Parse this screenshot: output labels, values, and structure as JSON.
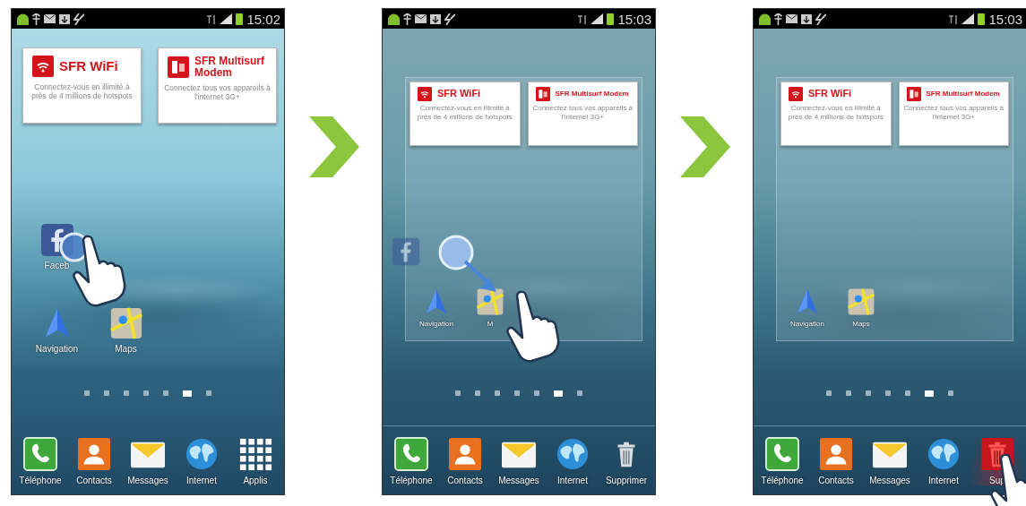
{
  "screens": [
    {
      "status_bar": {
        "time": "15:02"
      },
      "editing": false,
      "gesture": {
        "kind": "tap"
      },
      "widgets": [
        {
          "kind": "wifi",
          "title": "SFR WiFi",
          "text": "Connectez-vous en illimité à près de 4 millions de hotspots"
        },
        {
          "kind": "modem",
          "title": "SFR Multisurf Modem",
          "text": "Connectez tous vos appareils à l'internet 3G+"
        }
      ],
      "app_rows": [
        [
          {
            "kind": "facebook",
            "label": "Faceb",
            "dragging": false
          }
        ],
        [
          {
            "kind": "navigation",
            "label": "Navigation",
            "dragging": false
          },
          {
            "kind": "maps",
            "label": "Maps",
            "dragging": false
          }
        ]
      ],
      "page_dots": [
        {
          "selected": false
        },
        {
          "selected": false
        },
        {
          "selected": false
        },
        {
          "selected": false
        },
        {
          "selected": false
        },
        {
          "selected": true
        },
        {
          "selected": false
        }
      ],
      "dock": [
        {
          "kind": "phone",
          "label": "Téléphone",
          "highlighted": false
        },
        {
          "kind": "contacts",
          "label": "Contacts",
          "highlighted": false
        },
        {
          "kind": "messages",
          "label": "Messages",
          "highlighted": false
        },
        {
          "kind": "internet",
          "label": "Internet",
          "highlighted": false
        },
        {
          "kind": "apps",
          "label": "Applis",
          "highlighted": false
        }
      ]
    },
    {
      "status_bar": {
        "time": "15:03"
      },
      "editing": true,
      "gesture": {
        "kind": "drag"
      },
      "widgets": [
        {
          "kind": "wifi",
          "title": "SFR WiFi",
          "text": "Connectez-vous en illimité à près de 4 millions de hotspots"
        },
        {
          "kind": "modem",
          "title": "SFR Multisurf Modem",
          "text": "Connectez tous vos appareils à l'internet 3G+"
        }
      ],
      "app_rows": [
        [
          {
            "kind": "facebook",
            "dragging": true
          }
        ],
        [
          {
            "kind": "navigation",
            "label": "Navigation",
            "dragging": false
          },
          {
            "kind": "maps",
            "label": "M",
            "dragging": false
          }
        ]
      ],
      "page_dots": [
        {
          "selected": false
        },
        {
          "selected": false
        },
        {
          "selected": false
        },
        {
          "selected": false
        },
        {
          "selected": false
        },
        {
          "selected": true
        },
        {
          "selected": false
        }
      ],
      "dock": [
        {
          "kind": "phone",
          "label": "Téléphone",
          "highlighted": false
        },
        {
          "kind": "contacts",
          "label": "Contacts",
          "highlighted": false
        },
        {
          "kind": "messages",
          "label": "Messages",
          "highlighted": false
        },
        {
          "kind": "internet",
          "label": "Internet",
          "highlighted": false
        },
        {
          "kind": "trash",
          "label": "Supprimer",
          "highlighted": false
        }
      ]
    },
    {
      "status_bar": {
        "time": "15:03"
      },
      "editing": true,
      "gesture": {
        "kind": "delete"
      },
      "widgets": [
        {
          "kind": "wifi",
          "title": "SFR WiFi",
          "text": "Connectez-vous en illimité à près de 4 millions de hotspots"
        },
        {
          "kind": "modem",
          "title": "SFR Multisurf Modem",
          "text": "Connectez tous vos appareils à l'internet 3G+"
        }
      ],
      "app_rows": [
        [
          {
            "kind": "navigation",
            "label": "Navigation",
            "dragging": false
          },
          {
            "kind": "maps",
            "label": "Maps",
            "dragging": false
          }
        ]
      ],
      "page_dots": [
        {
          "selected": false
        },
        {
          "selected": false
        },
        {
          "selected": false
        },
        {
          "selected": false
        },
        {
          "selected": false
        },
        {
          "selected": true
        },
        {
          "selected": false
        }
      ],
      "dock": [
        {
          "kind": "phone",
          "label": "Téléphone",
          "highlighted": false
        },
        {
          "kind": "contacts",
          "label": "Contacts",
          "highlighted": false
        },
        {
          "kind": "messages",
          "label": "Messages",
          "highlighted": false
        },
        {
          "kind": "internet",
          "label": "Internet",
          "highlighted": false
        },
        {
          "kind": "trash",
          "label": "Sup",
          "highlighted": true
        }
      ]
    }
  ]
}
